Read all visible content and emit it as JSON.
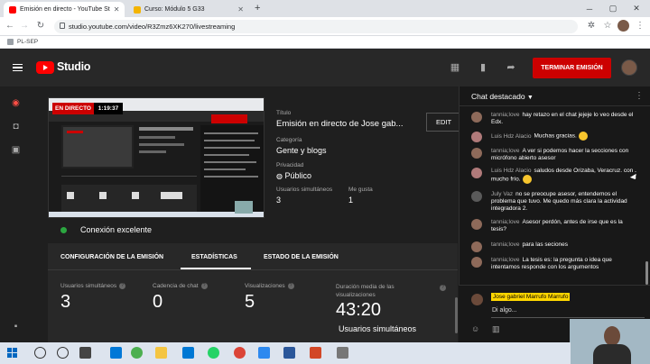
{
  "browser": {
    "tabs": [
      {
        "title": "Emisión en directo - YouTube St",
        "active": true
      },
      {
        "title": "Curso: Módulo 5 G33",
        "active": false
      }
    ],
    "new_tab": "+",
    "url": "studio.youtube.com/video/R3Zmz6XK270/livestreaming",
    "bookmark": "PL-SEP"
  },
  "header": {
    "logo_text": "Studio",
    "end_button": "TERMINAR EMISIÓN"
  },
  "preview": {
    "live_badge": "EN DIRECTO",
    "time": "1:19:37"
  },
  "stream": {
    "title_label": "Título",
    "title": "Emisión en directo de Jose gab...",
    "category_label": "Categoría",
    "category": "Gente y blogs",
    "privacy_label": "Privacidad",
    "privacy": "Público",
    "concurrent_label": "Usuarios simultáneos",
    "concurrent": "3",
    "likes_label": "Me gusta",
    "likes": "1",
    "edit": "EDIT"
  },
  "connection": "Conexión excelente",
  "tabs": [
    "CONFIGURACIÓN DE LA EMISIÓN",
    "ESTADÍSTICAS",
    "ESTADO DE LA EMISIÓN"
  ],
  "stats": [
    {
      "label": "Usuarios simultáneos",
      "value": "3"
    },
    {
      "label": "Cadencia de chat",
      "value": "0"
    },
    {
      "label": "Visualizaciones",
      "value": "5"
    },
    {
      "label": "Duración media de las visualizaciones",
      "value": "43:20"
    }
  ],
  "stats_footer": "Usuarios simultáneos",
  "chat": {
    "title": "Chat destacado",
    "messages": [
      {
        "author": "tannia;love",
        "text": "hay retazo en el chat jejeje lo veo desde el Edx.",
        "color": "#8e6a5a"
      },
      {
        "author": "Luis Hdz Alacio",
        "text": "Muchas gracias.",
        "color": "#b07a7a",
        "emoji": true
      },
      {
        "author": "tannia;love",
        "text": "A ver si podemos hacer la secciones con micrófono abierto asesor",
        "color": "#8e6a5a"
      },
      {
        "author": "Luis Hdz Alacio",
        "text": "saludos desde Orizaba, Veracruz. con mucho frío.",
        "color": "#b07a7a",
        "emoji": true
      },
      {
        "author": "July Vaz",
        "text": "no se preocupe asesor, entendemos el problema que tuvo. Me quedo más clara la actividad integradora 2.",
        "color": "#5a5a5a"
      },
      {
        "author": "tannia;love",
        "text": "Asesor perdón, antes de irse que es la tesis?",
        "color": "#8e6a5a"
      },
      {
        "author": "tannia;love",
        "text": "para las seciones",
        "color": "#8e6a5a"
      },
      {
        "author": "tannia;love",
        "text": "La tesis es: la pregunta o idea que intentamos responde con los argumentos",
        "color": "#8e6a5a"
      }
    ],
    "me": "Jose gabriel Marrufo Marrufo",
    "input_value": "Di algo..."
  },
  "colors": {
    "accent": "#cc0000",
    "live_green": "#2ba640",
    "author_highlight": "#ffd600"
  }
}
